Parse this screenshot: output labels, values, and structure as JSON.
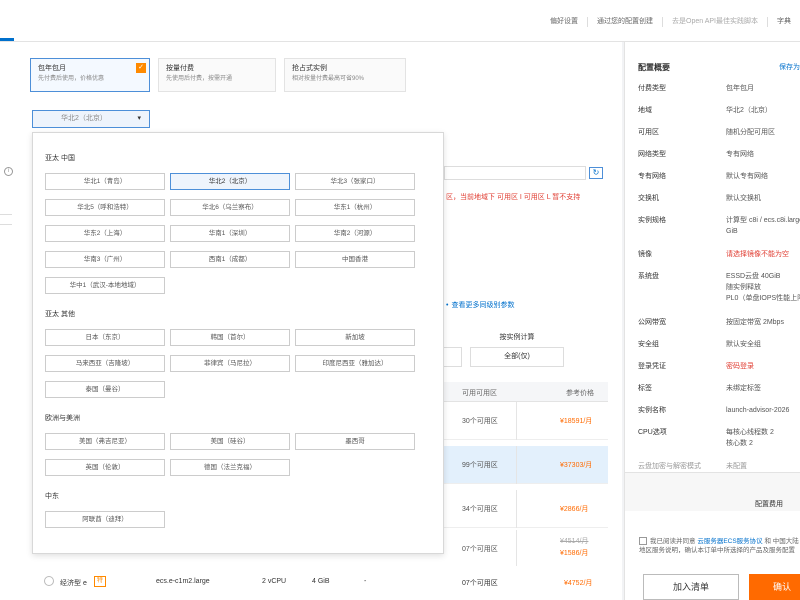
{
  "topbar": {
    "links": [
      "偏好设置",
      "通过您的配置创建",
      "去是Open API最佳实践脚本",
      "字典"
    ],
    "accent": "#0070cc"
  },
  "billing": {
    "cards": [
      {
        "title": "包年包月",
        "desc": "先付费后使用，价格优惠",
        "selected": true
      },
      {
        "title": "按量付费",
        "desc": "先使用后付费，按需开通",
        "selected": false
      },
      {
        "title": "抢占式实例",
        "desc": "相对按量付费最高可省90%",
        "selected": false
      }
    ],
    "check_glyph": "✓"
  },
  "region_select": {
    "value": "华北2（北京）",
    "caret": "▾"
  },
  "zone": {
    "refresh_icon": "↻",
    "warning": "区，当前地域下 可用区 I 可用区 L 暂不支持"
  },
  "table": {
    "link": "查看更多同级别参数",
    "billing_header": "按实例计算",
    "billing_value": "全部(仅)",
    "headers": {
      "zones": "可用可用区",
      "price": "参考价格"
    },
    "rows": [
      {
        "zones": "30个可用区",
        "price": "¥18591/月",
        "old": "",
        "hl": false
      },
      {
        "zones": "99个可用区",
        "price": "¥37303/月",
        "old": "",
        "hl": true
      },
      {
        "zones": "34个可用区",
        "price": "¥2866/月",
        "old": "",
        "hl": false
      },
      {
        "zones": "07个可用区",
        "price": "¥1586/月",
        "old": "¥4514/月",
        "hl": false
      }
    ]
  },
  "bottom_row": {
    "name": "经济型 e",
    "tag": "特",
    "spec": "ecs.e-c1m2.large",
    "cpu": "2 vCPU",
    "mem": "4 GiB",
    "dash": "-",
    "zones": "07个可用区",
    "price": "¥4752/月"
  },
  "dropdown": {
    "groups": [
      {
        "label": "亚太 中国",
        "options": [
          "华北1（青岛）",
          "华北2（北京）",
          "华北3（张家口）",
          "华北5（呼和浩特）",
          "华北6（乌兰察布）",
          "华东1（杭州）",
          "华东2（上海）",
          "华南1（深圳）",
          "华南2（河源）",
          "华南3（广州）",
          "西南1（成都）",
          "中国香港",
          "华中1（武汉-本地地域）"
        ]
      },
      {
        "label": "亚太 其他",
        "options": [
          "日本（东京）",
          "韩国（首尔）",
          "新加坡",
          "马来西亚（吉隆坡）",
          "印度尼西亚（雅加达）",
          "菲律宾（马尼拉）",
          "泰国（曼谷）"
        ]
      },
      {
        "label": "欧洲与美洲",
        "options": [
          "美国（弗吉尼亚）",
          "美国（硅谷）",
          "墨西哥",
          "英国（伦敦）",
          "德国（法兰克福）"
        ]
      },
      {
        "label": "中东",
        "options": [
          "阿联酋（迪拜）"
        ]
      }
    ],
    "selected": "华北2（北京）"
  },
  "sidebar": {
    "title": "配置概要",
    "save": "保存为",
    "rows": [
      {
        "k": "付费类型",
        "v": "包年包月"
      },
      {
        "k": "地域",
        "v": "华北2（北京）"
      },
      {
        "k": "可用区",
        "v": "随机分配可用区"
      },
      {
        "k": "网络类型",
        "v": "专有网络"
      },
      {
        "k": "专有网络",
        "v": "默认专有网络"
      },
      {
        "k": "交换机",
        "v": "默认交换机"
      },
      {
        "k": "实例规格",
        "v": "计算型 c8i / ecs.c8i.large",
        "v2": "GiB"
      },
      {
        "k": "镜像",
        "v": "请选择镜像不能为空",
        "red": true
      },
      {
        "k": "系统盘",
        "v": "ESSD云盘 40GiB",
        "v2": "随实例释放",
        "v3": "PL0（单盘IOPS性能上限）"
      },
      {
        "k": "公网带宽",
        "v": "按固定带宽 2Mbps"
      },
      {
        "k": "安全组",
        "v": "默认安全组"
      },
      {
        "k": "登录凭证",
        "v": "密码登录",
        "red": true
      },
      {
        "k": "标签",
        "v": "未绑定标签"
      },
      {
        "k": "实例名称",
        "v": "launch-advisor-2026"
      },
      {
        "k": "CPU选项",
        "v": "每核心线程数 2",
        "v2": "核心数 2"
      },
      {
        "k": "云盘加密与解密模式",
        "v": "未配置",
        "muted": true
      }
    ],
    "total_label": "配置费用",
    "agreement": "我已阅读并同意 云服务器ECS服务协议 和 中国大陆地区服务说明，确认本订单中所选择的产品及服务配置",
    "agreement_link": "云服务器ECS服务协议",
    "cart_button": "加入清单",
    "confirm_button": "确认"
  }
}
